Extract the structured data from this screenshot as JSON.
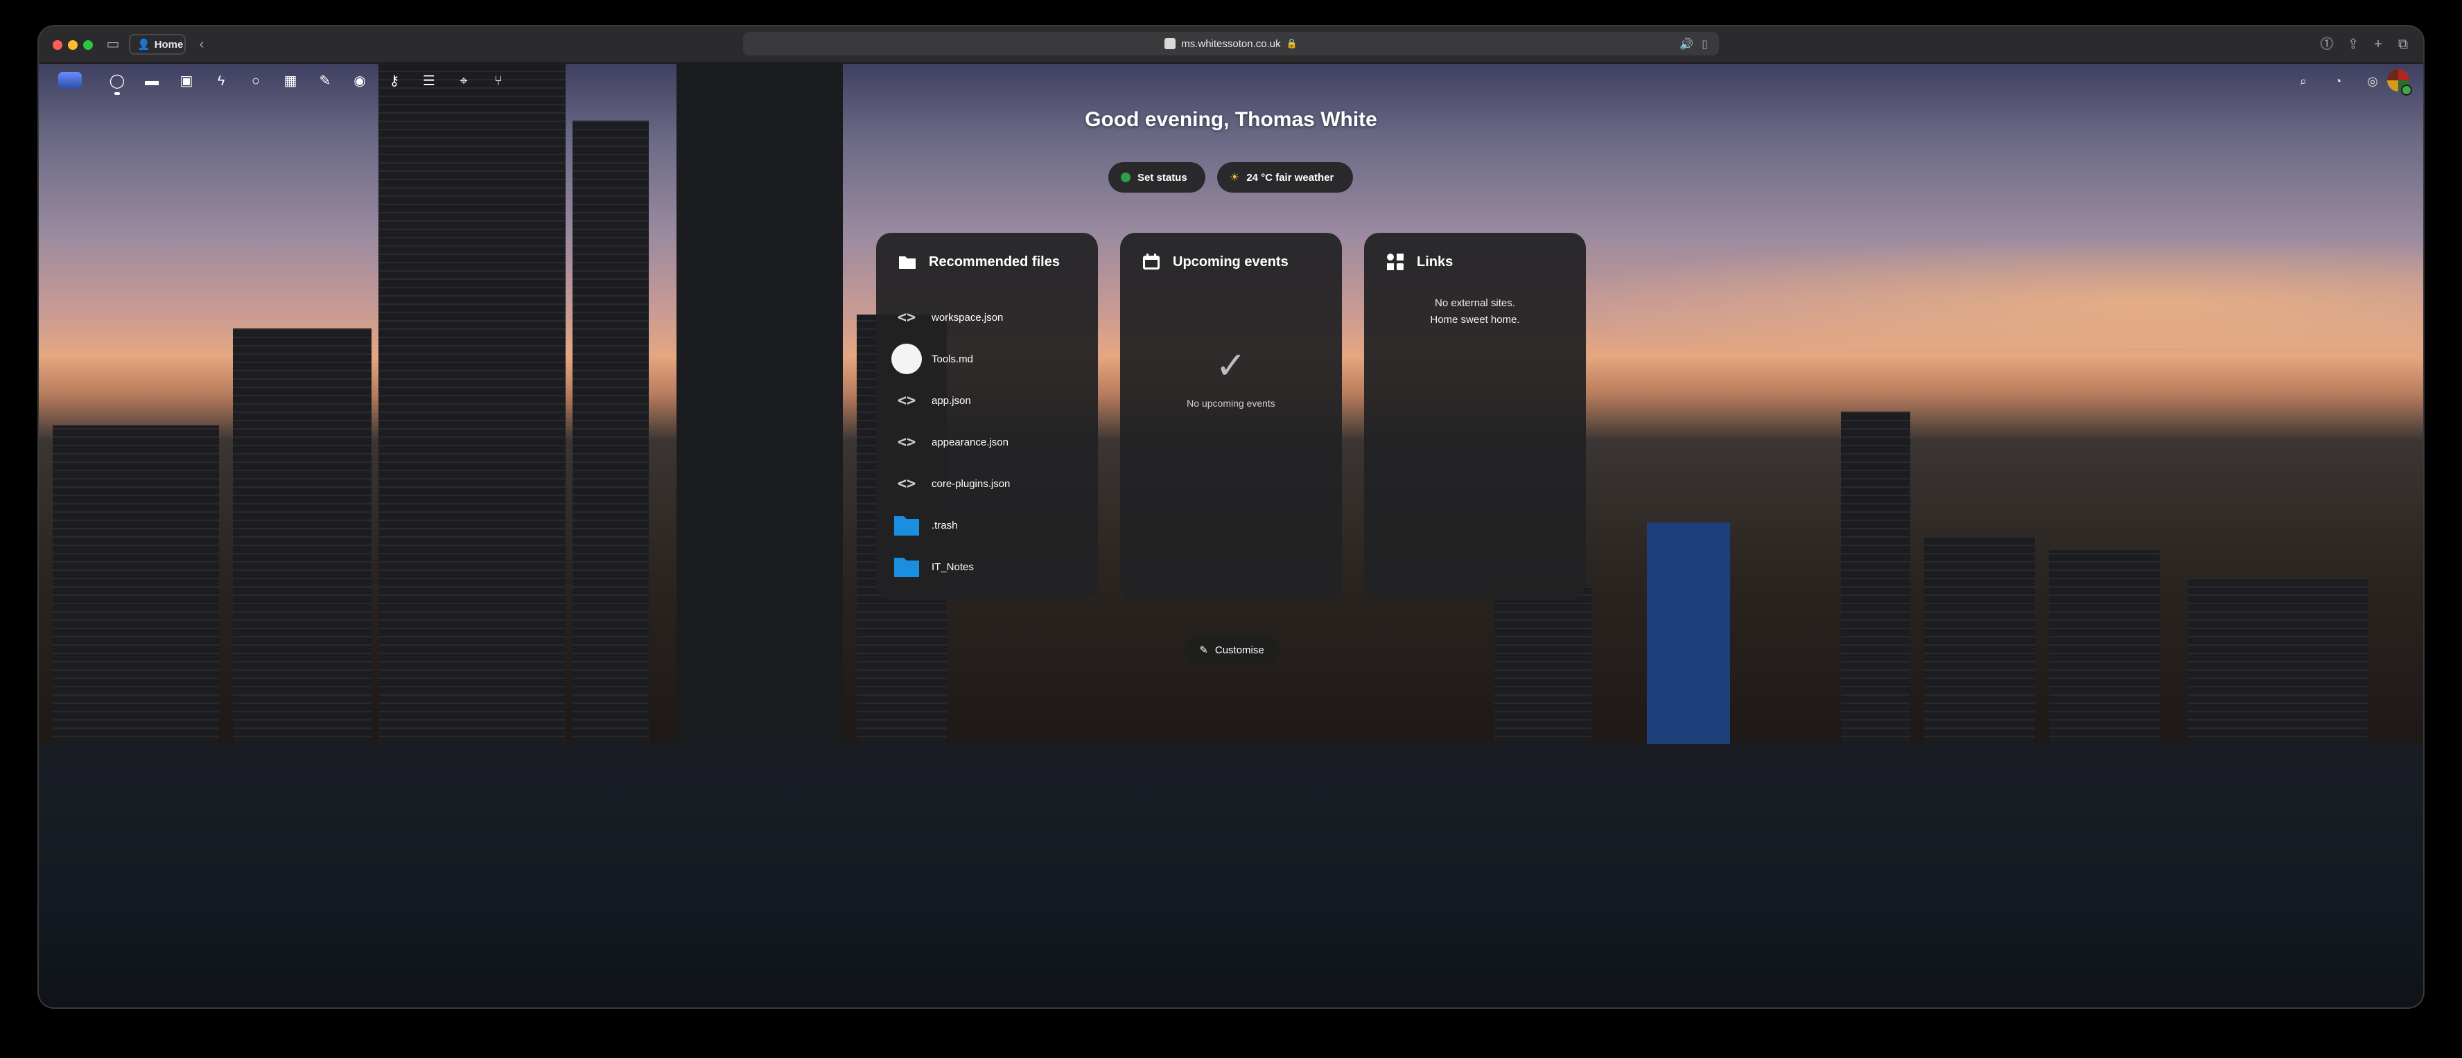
{
  "browser": {
    "profile_label": "Home",
    "url": "ms.whitessoton.co.uk"
  },
  "appbar": {
    "nav_icons": [
      "dashboard-icon",
      "files-icon",
      "photos-icon",
      "activity-icon",
      "talk-icon",
      "calendar-icon",
      "notes-icon",
      "maps-icon",
      "passwords-icon",
      "deck-icon",
      "location-icon",
      "cookbook-icon"
    ]
  },
  "greeting": "Good evening, Thomas White",
  "status": {
    "set_status_label": "Set status",
    "weather_label": "24 °C fair weather"
  },
  "widgets": {
    "recommended": {
      "title": "Recommended files",
      "files": [
        {
          "name": "workspace.json",
          "icon": "code"
        },
        {
          "name": "Tools.md",
          "icon": "circle"
        },
        {
          "name": "app.json",
          "icon": "code"
        },
        {
          "name": "appearance.json",
          "icon": "code"
        },
        {
          "name": "core-plugins.json",
          "icon": "code"
        },
        {
          "name": ".trash",
          "icon": "folder"
        },
        {
          "name": "IT_Notes",
          "icon": "folder"
        }
      ]
    },
    "events": {
      "title": "Upcoming events",
      "empty_text": "No upcoming events"
    },
    "links": {
      "title": "Links",
      "line1": "No external sites.",
      "line2": "Home sweet home."
    }
  },
  "customise_label": "Customise",
  "colors": {
    "folder_blue": "#1a8fe0",
    "status_green": "#2e9e4c"
  }
}
